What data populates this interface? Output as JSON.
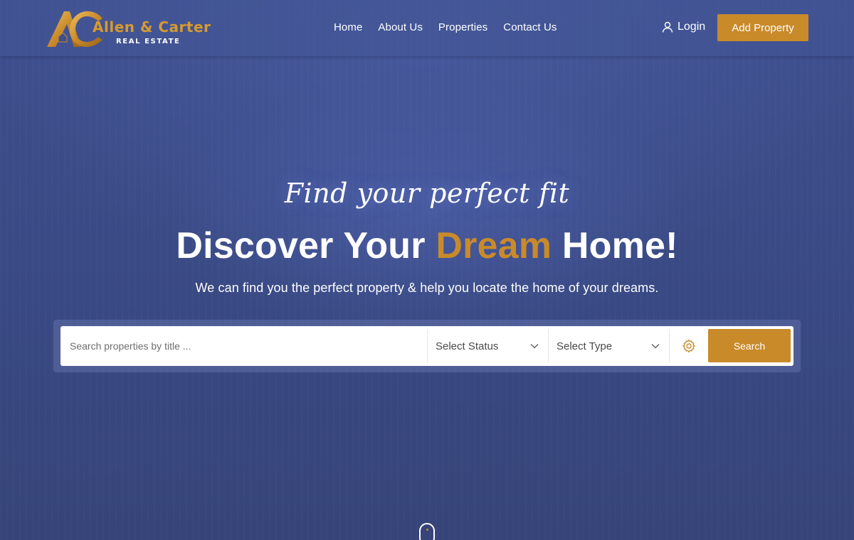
{
  "brand": {
    "name": "Allen & Carter",
    "sub": "REAL ESTATE",
    "accent_color": "#c98a2a"
  },
  "nav": {
    "items": [
      {
        "label": "Home"
      },
      {
        "label": "About Us"
      },
      {
        "label": "Properties"
      },
      {
        "label": "Contact Us"
      }
    ],
    "login_label": "Login",
    "add_property_label": "Add Property"
  },
  "hero": {
    "tagline": "Find your perfect fit",
    "headline_before": "Discover Your ",
    "headline_accent": "Dream",
    "headline_after": " Home!",
    "subline": "We can find you the perfect property & help you locate the home of your dreams."
  },
  "search": {
    "placeholder": "Search properties by title ...",
    "status_selected": "Select Status",
    "type_selected": "Select Type",
    "button_label": "Search"
  },
  "icons": {
    "user": "user-icon",
    "chevron": "chevron-down-icon",
    "gear": "gear-icon",
    "scroll": "mouse-scroll-icon"
  }
}
